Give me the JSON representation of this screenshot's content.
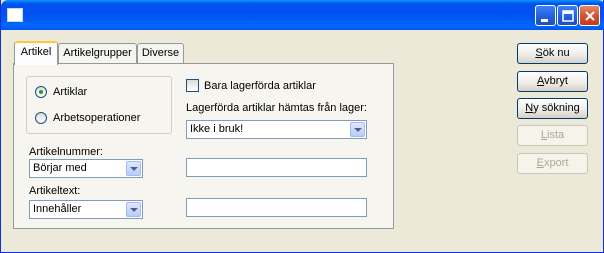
{
  "window": {
    "title": ""
  },
  "tabs": [
    {
      "label": "Artikel",
      "active": true
    },
    {
      "label": "Artikelgrupper",
      "active": false
    },
    {
      "label": "Diverse",
      "active": false
    }
  ],
  "radio_group": {
    "options": [
      {
        "label": "Artiklar",
        "checked": true
      },
      {
        "label": "Arbetsoperationer",
        "checked": false
      }
    ]
  },
  "stock_only": {
    "label": "Bara lagerförda artiklar",
    "checked": false
  },
  "warehouse": {
    "label": "Lagerförda artiklar hämtas från lager:",
    "value": "Ikke i bruk!"
  },
  "article_number": {
    "label": "Artikelnummer:",
    "operator": "Börjar med",
    "value": ""
  },
  "article_text": {
    "label": "Artikeltext:",
    "operator": "Innehåller",
    "value": ""
  },
  "buttons": {
    "search": {
      "mnemonic": "S",
      "rest": "ök nu",
      "enabled": true
    },
    "cancel": {
      "mnemonic": "A",
      "rest": "vbryt",
      "enabled": true
    },
    "new_search": {
      "mnemonic": "N",
      "rest": "y sökning",
      "enabled": true
    },
    "list": {
      "mnemonic": "L",
      "rest": "ista",
      "enabled": false
    },
    "export": {
      "mnemonic": "E",
      "rest": "xport",
      "enabled": false
    }
  },
  "colors": {
    "titlebar": "#0054e3",
    "dialog_bg": "#ece9d8",
    "tab_highlight": "#ffc83c",
    "radio_dot": "#21a121"
  }
}
